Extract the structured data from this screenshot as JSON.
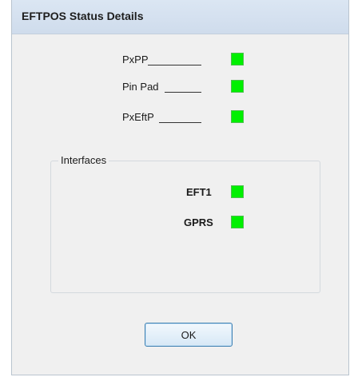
{
  "window": {
    "title": "EFTPOS Status Details"
  },
  "status_items": [
    {
      "label": "PxPP",
      "state": "ok",
      "color": "#00f000"
    },
    {
      "label": "Pin Pad",
      "state": "ok",
      "color": "#00f000"
    },
    {
      "label": "PxEftP",
      "state": "ok",
      "color": "#00f000"
    }
  ],
  "interfaces": {
    "title": "Interfaces",
    "items": [
      {
        "label": "EFT1",
        "state": "ok",
        "color": "#00f000"
      },
      {
        "label": "GPRS",
        "state": "ok",
        "color": "#00f000"
      }
    ]
  },
  "buttons": {
    "ok_label": "OK"
  }
}
